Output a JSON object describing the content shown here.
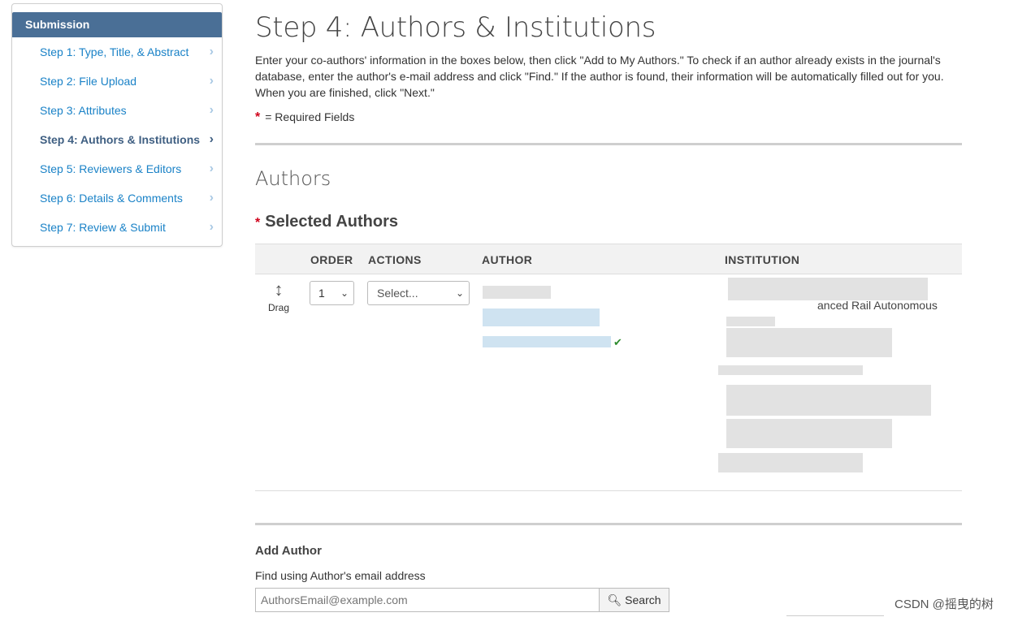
{
  "sidebar": {
    "header": "Submission",
    "items": [
      {
        "label": "Step 1: Type, Title, & Abstract"
      },
      {
        "label": "Step 2: File Upload"
      },
      {
        "label": "Step 3: Attributes"
      },
      {
        "label": "Step 4: Authors & Institutions",
        "active": true
      },
      {
        "label": "Step 5: Reviewers & Editors"
      },
      {
        "label": "Step 6: Details & Comments"
      },
      {
        "label": "Step 7: Review & Submit"
      }
    ]
  },
  "page": {
    "title": "Step 4: Authors & Institutions",
    "intro": "Enter your co-authors' information in the boxes below, then click \"Add to My Authors.\" To check if an author already exists in the journal's database, enter the author's e-mail address and click \"Find.\" If the author is found, their information will be automatically filled out for you. When you are finished, click \"Next.\"",
    "required_star": "*",
    "required_legend": "= Required Fields"
  },
  "authors": {
    "section_title": "Authors",
    "selected_star": "*",
    "selected_title": "Selected Authors",
    "columns": {
      "order": "ORDER",
      "actions": "ACTIONS",
      "author": "AUTHOR",
      "institution": "INSTITUTION"
    },
    "row": {
      "drag_label": "Drag",
      "order_value": "1",
      "actions_placeholder": "Select...",
      "institution_visible_fragment": "anced Rail Autonomous"
    }
  },
  "add_author": {
    "title": "Add Author",
    "find_label": "Find using Author's email address",
    "email_placeholder": "AuthorsEmail@example.com",
    "search_label": "Search"
  },
  "watermark": "CSDN @摇曳的树",
  "icons": {
    "chevron": "chevron-right-icon",
    "drag": "vertical-arrows-icon",
    "search": "magnifier-icon",
    "check": "checkmark-icon"
  },
  "colors": {
    "sidebar_header": "#4a6f96",
    "link": "#1a82c7",
    "active": "#3f5f82",
    "required": "#d0021b"
  }
}
